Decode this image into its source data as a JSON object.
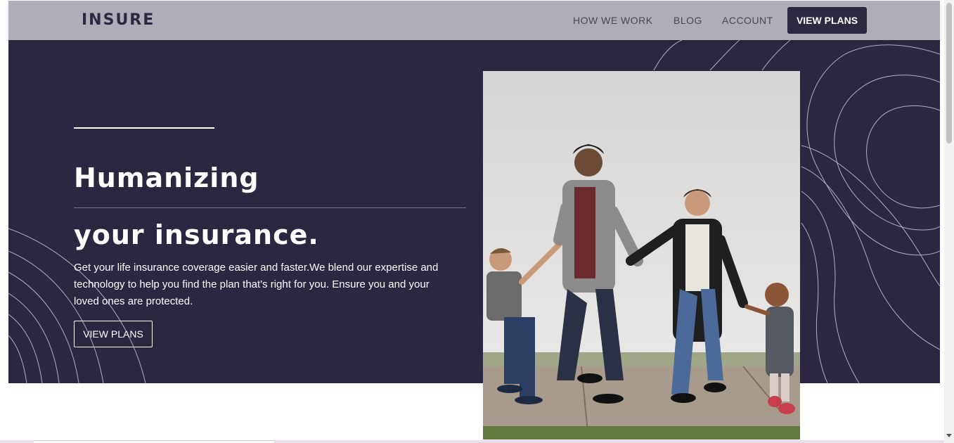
{
  "header": {
    "logo": "INSURE",
    "nav": {
      "how_we_work": "HOW WE WORK",
      "blog": "BLOG",
      "account": "ACCOUNT",
      "view_plans": "VIEW PLANS"
    }
  },
  "hero": {
    "title_line_1": "Humanizing",
    "title_line_2": "your insurance.",
    "body": "Get your life insurance coverage easier and faster.We blend our expertise and technology to help you find the plan that's right for you. Ensure you and your loved ones are protected.",
    "cta": "VIEW PLANS"
  },
  "colors": {
    "header_bg": "#b0acb8",
    "hero_bg": "#2d2640",
    "brand_dark": "#2d2740",
    "text_light": "#ffffff"
  }
}
